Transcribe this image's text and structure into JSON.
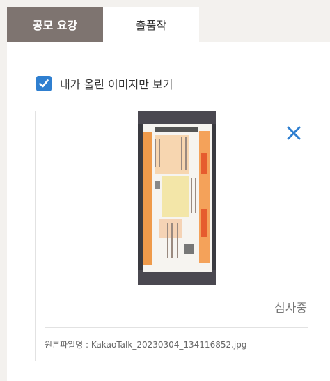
{
  "tabs": [
    {
      "label": "공모 요강",
      "active": true
    },
    {
      "label": "출품작",
      "active": false
    }
  ],
  "filter": {
    "checked": true,
    "label": "내가 올린 이미지만 보기"
  },
  "card": {
    "status": "심사중",
    "filename_label": "원본파일명 :",
    "filename": "KakaoTalk_20230304_134116852.jpg"
  },
  "icons": {
    "checkbox": "check-icon",
    "close": "close-icon"
  },
  "colors": {
    "tab_active_bg": "#7e7470",
    "accent_blue": "#2f7fd0",
    "page_bg": "#f3f1ee"
  }
}
